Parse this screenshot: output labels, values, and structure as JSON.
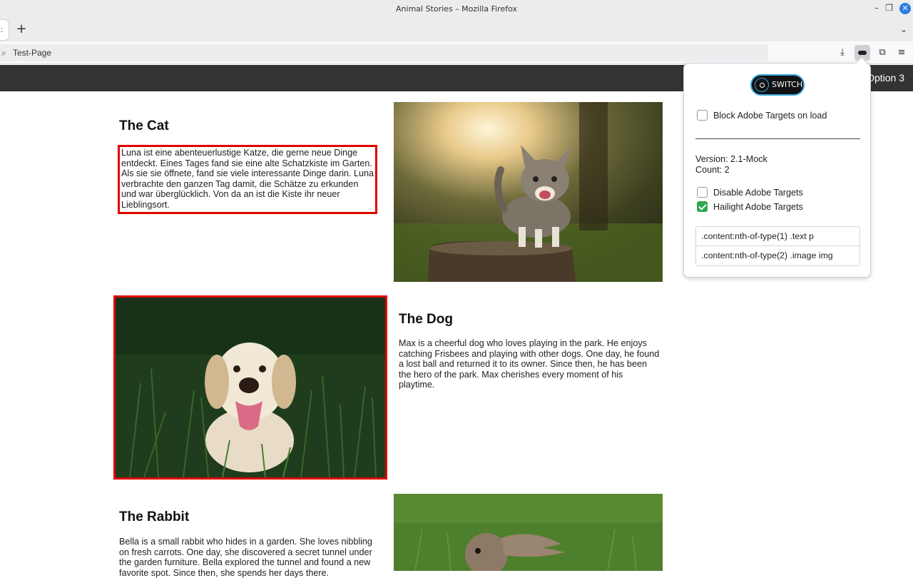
{
  "window": {
    "title": "Animal Stories – Mozilla Firefox"
  },
  "urlbar": {
    "text": "Test-Page"
  },
  "page_nav": {
    "option": "Option 3"
  },
  "articles": {
    "cat": {
      "title": "The Cat",
      "text": "Luna ist eine abenteuerlustige Katze, die gerne neue Dinge entdeckt. Eines Tages fand sie eine alte Schatzkiste im Garten. Als sie sie öffnete, fand sie viele interessante Dinge darin. Luna verbrachte den ganzen Tag damit, die Schätze zu erkunden und war überglücklich. Von da an ist die Kiste ihr neuer Lieblingsort."
    },
    "dog": {
      "title": "The Dog",
      "text": "Max is a cheerful dog who loves playing in the park. He enjoys catching Frisbees and playing with other dogs. One day, he found a lost ball and returned it to its owner. Since then, he has been the hero of the park. Max cherishes every moment of his playtime."
    },
    "rabbit": {
      "title": "The Rabbit",
      "text": "Bella is a small rabbit who hides in a garden. She loves nibbling on fresh carrots. One day, she discovered a secret tunnel under the garden furniture. Bella explored the tunnel and found a new favorite spot. Since then, she spends her days there."
    }
  },
  "popup": {
    "logo_text": "SWITCH",
    "block_on_load": {
      "label": "Block Adobe Targets on load",
      "checked": false
    },
    "version": "Version: 2.1-Mock",
    "count": "Count: 2",
    "disable": {
      "label": "Disable Adobe Targets",
      "checked": false
    },
    "hailight": {
      "label": "Hailight Adobe Targets",
      "checked": true
    },
    "selectors": [
      ".content:nth-of-type(1) .text p",
      ".content:nth-of-type(2) .image img"
    ]
  },
  "colors": {
    "highlight": "#e00000",
    "nav_bg": "#333333",
    "checkbox_checked": "#2fa84f",
    "logo_accent": "#37a7d9"
  }
}
